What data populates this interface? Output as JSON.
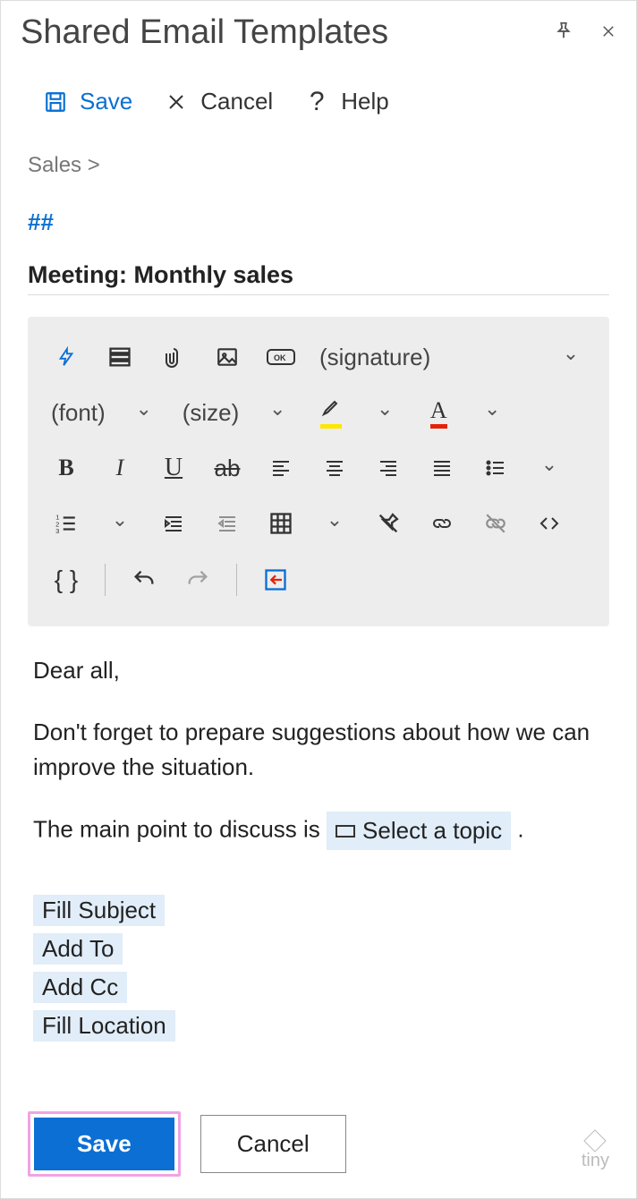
{
  "header": {
    "title": "Shared Email Templates"
  },
  "actions": {
    "save": "Save",
    "cancel": "Cancel",
    "help": "Help"
  },
  "breadcrumb": "Sales  >",
  "shortcut": "##",
  "subject": "Meeting: Monthly sales",
  "toolbar": {
    "signature": "(signature)",
    "font": "(font)",
    "size": "(size)"
  },
  "body": {
    "greeting": "Dear all,",
    "para1": "Don't forget to prepare suggestions about how we can improve the situation.",
    "para2_prefix": "The main point to discuss is ",
    "para2_token": "Select a topic",
    "para2_suffix": " ."
  },
  "macros": [
    "Fill Subject",
    "Add To",
    "Add Cc",
    "Fill Location"
  ],
  "footer": {
    "save": "Save",
    "cancel": "Cancel",
    "brand": "tiny"
  }
}
